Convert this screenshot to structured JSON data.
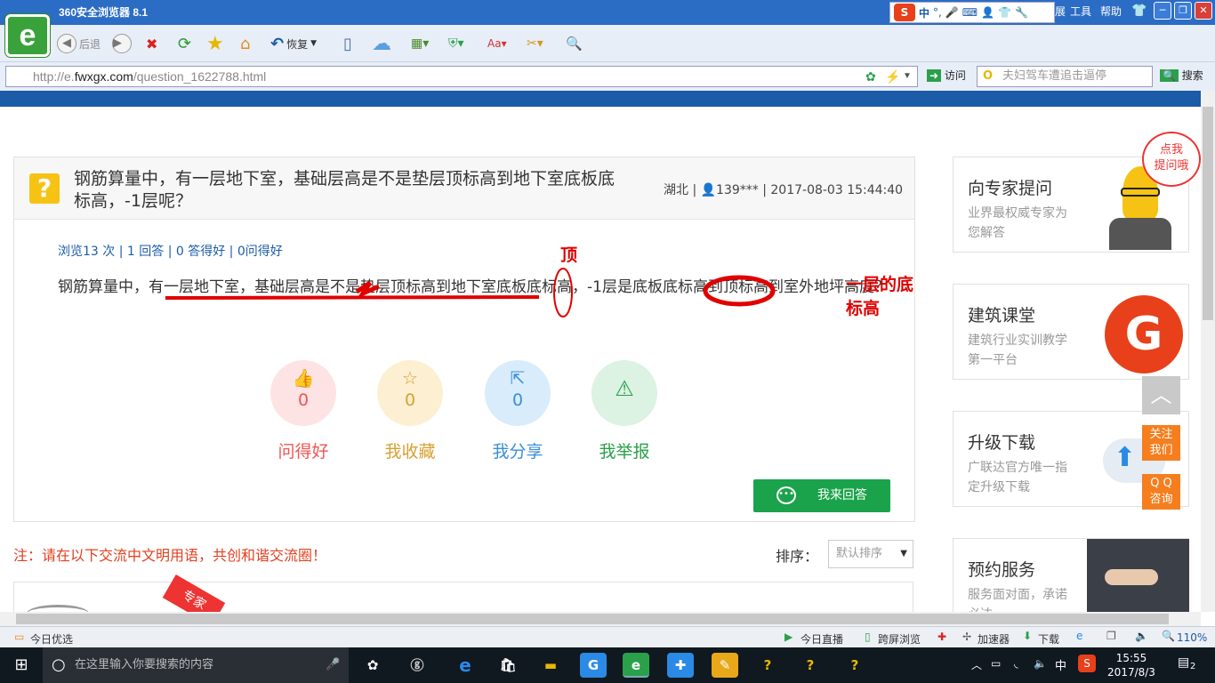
{
  "browser": {
    "title": "360安全浏览器 8.1",
    "menu": [
      "扩展",
      "工具",
      "帮助"
    ],
    "toolbar": {
      "back": "后退",
      "restore": "恢复"
    },
    "address": {
      "scheme": "http://e.",
      "host": "fwxgx.com",
      "path": "/question_1622788.html"
    },
    "visit_label": "访问",
    "search_placeholder": "夫妇驾车遭追击逼停",
    "search_label": "搜索",
    "ime_label": "中"
  },
  "question": {
    "title": "钢筋算量中，有一层地下室，基础层高是不是垫层顶标高到地下室底板底标高，-1层呢？",
    "meta": "湖北 | 👤139*** | 2017-08-03 15:44:40",
    "stats": "浏览13 次 | 1 回答 | 0 答得好 | 0问得好",
    "body": "钢筋算量中，有一层地下室，基础层高是不是垫层顶标高到地下室底板底标高，-1层是底板底标高到顶标高到室外地坪高度？",
    "annotation_top": "顶",
    "annotation_right": "一层的底标高",
    "actions": [
      {
        "label": "问得好",
        "count": "0",
        "icon": "thumbs-up-icon"
      },
      {
        "label": "我收藏",
        "count": "0",
        "icon": "star-icon"
      },
      {
        "label": "我分享",
        "count": "0",
        "icon": "share-icon"
      },
      {
        "label": "我举报",
        "icon": "warning-icon"
      }
    ],
    "answer_button": "我来回答"
  },
  "notice": "注：请在以下交流中文明用语，共创和谐交流圈！",
  "sort": {
    "label": "排序：",
    "value": "默认排序"
  },
  "badge": "专家",
  "sidebar": {
    "bubble": "点我\n提问哦",
    "cards": [
      {
        "title": "向专家提问",
        "desc": "业界最权威专家为您解答"
      },
      {
        "title": "建筑课堂",
        "desc": "建筑行业实训教学第一平台"
      },
      {
        "title": "升级下载",
        "desc": "广联达官方唯一指定升级下载"
      },
      {
        "title": "预约服务",
        "desc": "服务面对面，承诺必达"
      }
    ],
    "follow": "关注\n我们",
    "qq": "Q Q\n咨询"
  },
  "statusbar": {
    "left": "今日优选",
    "items": [
      "今日直播",
      "跨屏浏览",
      "加速器",
      "下载"
    ],
    "zoom": "110%"
  },
  "taskbar": {
    "search_placeholder": "在这里输入你要搜索的内容",
    "time": "15:55",
    "date": "2017/8/3",
    "ime": "中",
    "notifications": "2"
  },
  "colors": {
    "accent_blue": "#1b5ba8",
    "green": "#1aa34a",
    "orange": "#f57e1e",
    "red": "#e00000"
  }
}
